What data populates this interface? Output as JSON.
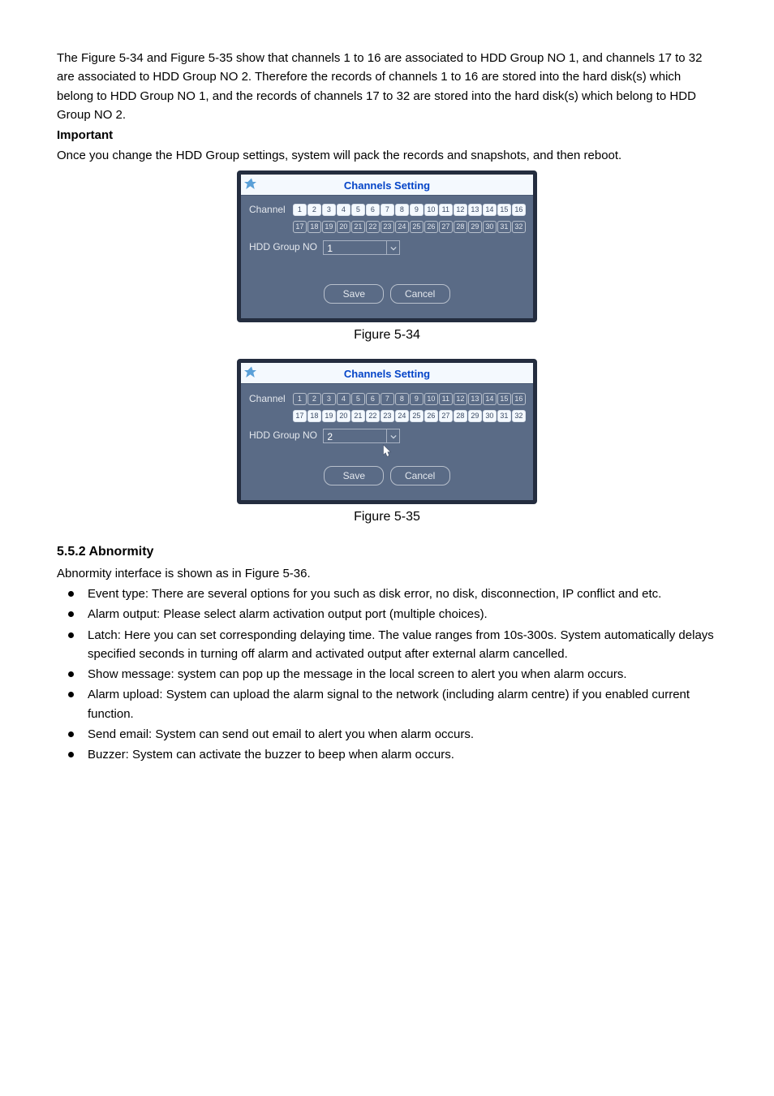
{
  "intro": {
    "p1": "The Figure 5-34 and Figure 5-35 show that channels 1 to 16 are associated to HDD Group NO 1, and channels 17 to 32 are associated to HDD Group NO 2. Therefore the records of channels 1 to 16 are stored into the hard disk(s) which belong to HDD Group NO 1, and the records of channels 17 to 32 are stored into the hard disk(s) which belong to HDD Group NO 2.",
    "important": "Important",
    "p2": "Once you change the HDD Group settings, system will pack the records and snapshots, and then reboot."
  },
  "dialog1": {
    "title": "Channels Setting",
    "channel_label": "Channel",
    "row1": [
      "1",
      "2",
      "3",
      "4",
      "5",
      "6",
      "7",
      "8",
      "9",
      "10",
      "11",
      "12",
      "13",
      "14",
      "15",
      "16"
    ],
    "row2": [
      "17",
      "18",
      "19",
      "20",
      "21",
      "22",
      "23",
      "24",
      "25",
      "26",
      "27",
      "28",
      "29",
      "30",
      "31",
      "32"
    ],
    "row1_state": "on",
    "row2_state": "off",
    "hdd_label": "HDD Group NO",
    "hdd_value": "1",
    "save": "Save",
    "cancel": "Cancel"
  },
  "fig1_cap": "Figure 5-34",
  "dialog2": {
    "title": "Channels Setting",
    "channel_label": "Channel",
    "row1": [
      "1",
      "2",
      "3",
      "4",
      "5",
      "6",
      "7",
      "8",
      "9",
      "10",
      "11",
      "12",
      "13",
      "14",
      "15",
      "16"
    ],
    "row2": [
      "17",
      "18",
      "19",
      "20",
      "21",
      "22",
      "23",
      "24",
      "25",
      "26",
      "27",
      "28",
      "29",
      "30",
      "31",
      "32"
    ],
    "row1_state": "off",
    "row2_state": "on",
    "hdd_label": "HDD Group NO",
    "hdd_value": "2",
    "save": "Save",
    "cancel": "Cancel"
  },
  "fig2_cap": "Figure 5-35",
  "section": {
    "num_title": "5.5.2  Abnormity",
    "intro": "Abnormity interface is shown as in Figure 5-36.",
    "items": [
      "Event type: There are several options for you such as disk error, no disk, disconnection, IP conflict and etc.",
      "Alarm output: Please select alarm activation output port (multiple choices).",
      "Latch: Here you can set corresponding delaying time. The value ranges from 10s-300s. System automatically delays specified seconds in turning off alarm and activated output after external alarm cancelled.",
      "Show message: system can pop up the message in the local screen to alert you when alarm occurs.",
      "Alarm upload: System can upload the alarm signal to the network (including alarm centre) if you enabled current function.",
      "Send email: System can send out email to alert you when alarm occurs.",
      "Buzzer: System can activate the buzzer to beep when alarm occurs."
    ]
  }
}
